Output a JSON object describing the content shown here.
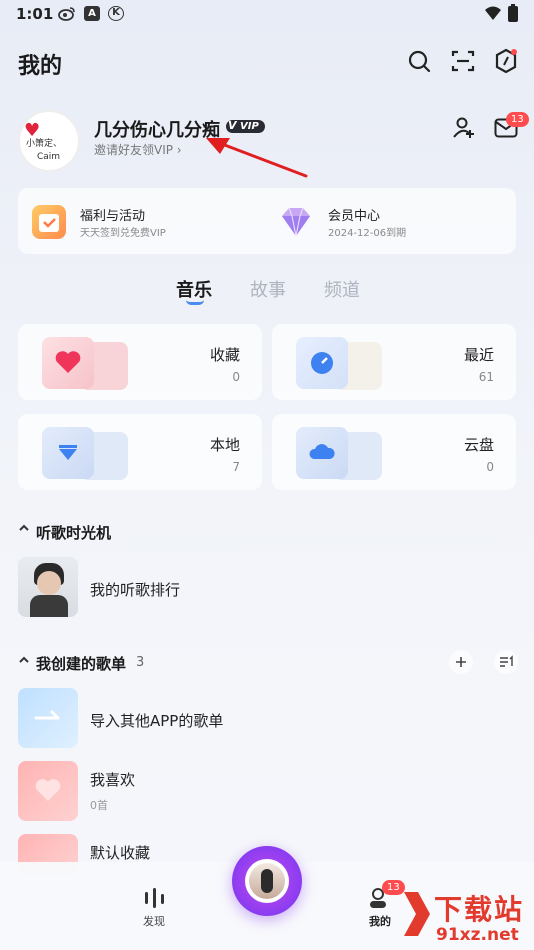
{
  "status_bar": {
    "time": "1:01",
    "icons": [
      "weibo-icon",
      "a-icon",
      "k-icon"
    ],
    "right_icons": [
      "wifi-icon",
      "battery-icon"
    ]
  },
  "header": {
    "title": "我的",
    "icons": [
      "search-icon",
      "scan-icon",
      "settings-icon"
    ]
  },
  "profile": {
    "avatar_text_1": "小箫定、",
    "avatar_text_2": "Caim",
    "username": "几分伤心几分痴",
    "vip_label": "VIP",
    "invite_text": "邀请好友领VIP ›",
    "mail_badge": "13"
  },
  "welfare": {
    "left": {
      "title": "福利与活动",
      "subtitle": "天天签到兑免费VIP"
    },
    "right": {
      "title": "会员中心",
      "subtitle": "2024-12-06到期"
    }
  },
  "tabs": [
    "音乐",
    "故事",
    "频道"
  ],
  "grid": [
    {
      "label": "收藏",
      "count": "0"
    },
    {
      "label": "最近",
      "count": "61"
    },
    {
      "label": "本地",
      "count": "7"
    },
    {
      "label": "云盘",
      "count": "0"
    }
  ],
  "time_machine": {
    "title": "听歌时光机",
    "item": "我的听歌排行"
  },
  "my_playlists": {
    "title": "我创建的歌单",
    "count": "3",
    "items": [
      {
        "title": "导入其他APP的歌单",
        "sub": ""
      },
      {
        "title": "我喜欢",
        "sub": "0首"
      },
      {
        "title": "默认收藏",
        "sub": ""
      }
    ]
  },
  "bottom_nav": {
    "discover": "发现",
    "mine": "我的",
    "mine_badge": "13"
  },
  "watermark": {
    "text": "下载站",
    "url_text": "91xz.net"
  },
  "colors": {
    "accent": "#4a8cf0",
    "badge": "#ff4d4f",
    "player": "#8a3cf0",
    "annotation": "#e02020"
  }
}
